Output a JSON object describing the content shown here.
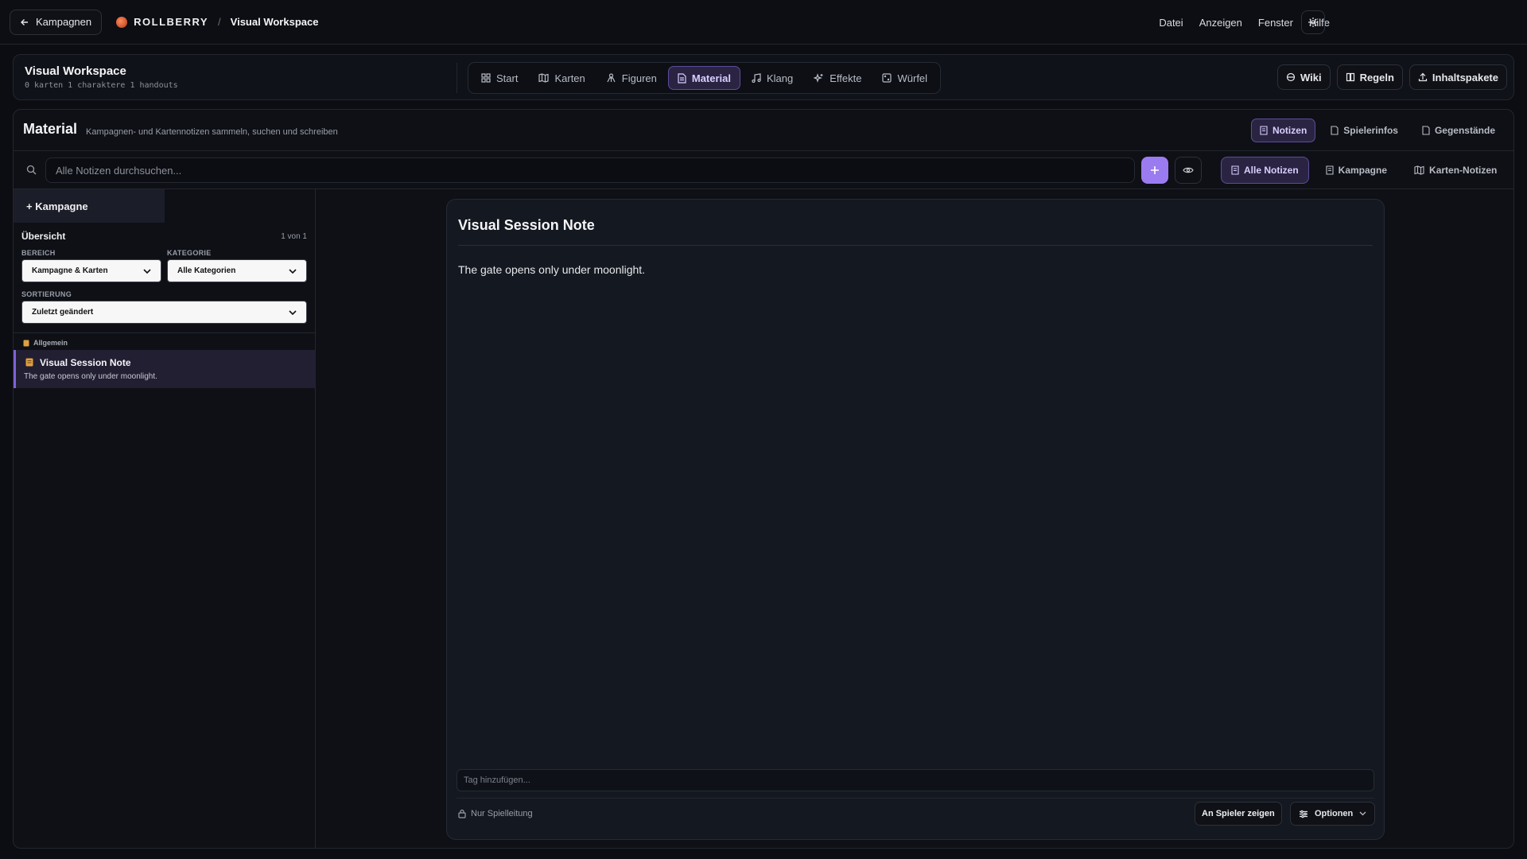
{
  "topbar": {
    "back_label": "Kampagnen",
    "brand_name": "ROLLBERRY",
    "separator": "/",
    "workspace": "Visual Workspace",
    "menu": [
      "Datei",
      "Anzeigen",
      "Fenster",
      "Hilfe"
    ]
  },
  "workspace": {
    "title": "Visual Workspace",
    "stats": "0 karten 1 charaktere 1 handouts",
    "tabs": [
      {
        "label": "Start",
        "icon": "grid-icon"
      },
      {
        "label": "Karten",
        "icon": "map-icon"
      },
      {
        "label": "Figuren",
        "icon": "figures-icon"
      },
      {
        "label": "Material",
        "icon": "document-icon",
        "active": true
      },
      {
        "label": "Klang",
        "icon": "music-icon"
      },
      {
        "label": "Effekte",
        "icon": "sparkles-icon"
      },
      {
        "label": "Würfel",
        "icon": "dice-icon"
      }
    ],
    "right_buttons": [
      {
        "label": "Wiki",
        "icon": "wiki-icon"
      },
      {
        "label": "Regeln",
        "icon": "book-icon"
      },
      {
        "label": "Inhaltspakete",
        "icon": "upload-icon"
      }
    ]
  },
  "material": {
    "title": "Material",
    "subtitle": "Kampagnen- und Kartennotizen sammeln, suchen und schreiben",
    "tabs": [
      "Notizen",
      "Spielerinfos",
      "Gegenstände"
    ],
    "search_placeholder": "Alle Notizen durchsuchen...",
    "filter_tabs": [
      "Alle Notizen",
      "Kampagne",
      "Karten-Notizen"
    ]
  },
  "sidebar": {
    "tab_label": "+ Kampagne",
    "overview_label": "Übersicht",
    "count": "1 von 1",
    "area_label": "BEREICH",
    "area_value": "Kampagne & Karten",
    "category_label": "KATEGORIE",
    "category_value": "Alle Kategorien",
    "sort_label": "SORTIERUNG",
    "sort_value": "Zuletzt geändert",
    "group_label": "Allgemein",
    "note": {
      "title": "Visual Session Note",
      "preview": "The gate opens only under moonlight."
    }
  },
  "editor": {
    "title": "Visual Session Note",
    "body": "The gate opens only under moonlight.",
    "tag_placeholder": "Tag hinzufügen...",
    "visibility": "Nur Spielleitung",
    "show_button": "An Spieler zeigen",
    "options_button": "Optionen"
  },
  "colors": {
    "accent": "#9b7bf0",
    "active_bg": "#2a2442",
    "background": "#0b0d12"
  }
}
